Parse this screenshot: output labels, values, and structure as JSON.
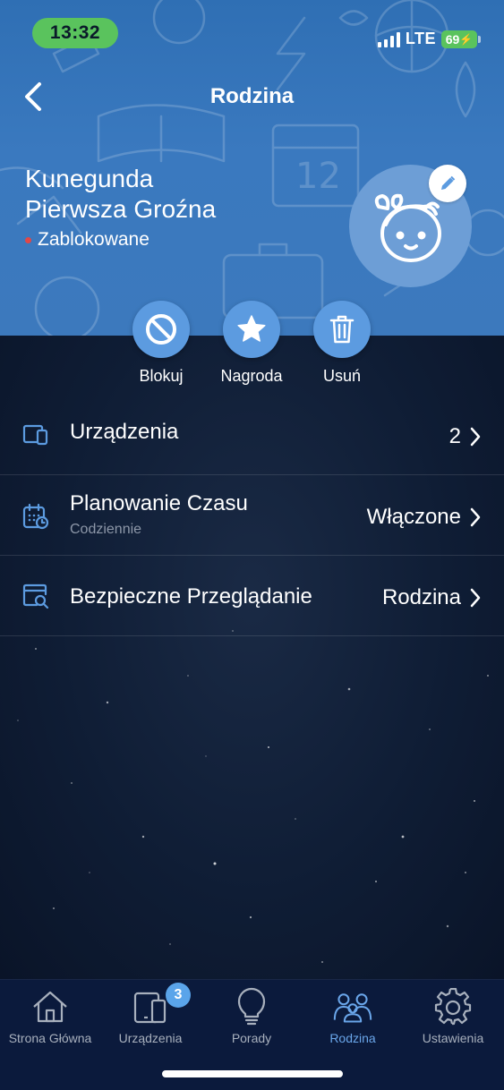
{
  "status_bar": {
    "time": "13:32",
    "network": "LTE",
    "battery": "69"
  },
  "nav": {
    "title": "Rodzina",
    "back_icon": "chevron-left-icon"
  },
  "profile": {
    "name_line1": "Kunegunda",
    "name_line2": "Pierwsza Groźna",
    "status": "Zablokowane",
    "status_color": "#e04848",
    "avatar_icon": "child-avatar-icon",
    "edit_icon": "pencil-icon"
  },
  "actions": [
    {
      "label": "Blokuj",
      "icon": "block-icon"
    },
    {
      "label": "Nagroda",
      "icon": "star-icon"
    },
    {
      "label": "Usuń",
      "icon": "trash-icon"
    }
  ],
  "list": [
    {
      "title": "Urządzenia",
      "subtitle": "",
      "value": "2",
      "icon": "devices-icon"
    },
    {
      "title": "Planowanie Czasu",
      "subtitle": "Codziennie",
      "value": "Włączone",
      "icon": "calendar-clock-icon"
    },
    {
      "title": "Bezpieczne Przeglądanie",
      "subtitle": "",
      "value": "Rodzina",
      "icon": "browser-search-icon"
    }
  ],
  "tabbar": {
    "active": "Rodzina",
    "items": [
      {
        "label": "Strona Główna",
        "icon": "home-icon"
      },
      {
        "label": "Urządzenia",
        "icon": "devices-icon",
        "badge": "3"
      },
      {
        "label": "Porady",
        "icon": "lightbulb-icon"
      },
      {
        "label": "Rodzina",
        "icon": "family-icon"
      },
      {
        "label": "Ustawienia",
        "icon": "gear-icon"
      }
    ]
  },
  "colors": {
    "accent": "#5c9be0",
    "tab_active": "#6aa6ea",
    "status_green": "#5ac35d"
  }
}
